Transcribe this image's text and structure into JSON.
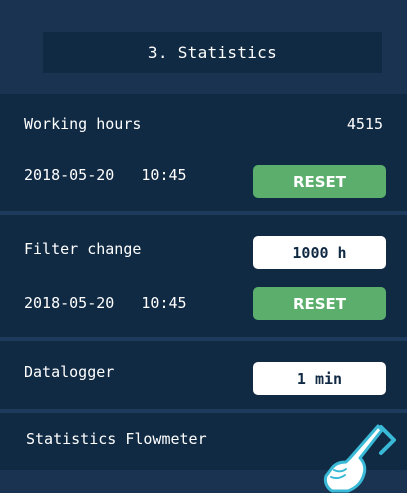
{
  "header": {
    "title": "3. Statistics"
  },
  "working_hours": {
    "label": "Working hours",
    "value": "4515",
    "date": "2018-05-20",
    "time": "10:45",
    "reset_label": "RESET"
  },
  "filter_change": {
    "label": "Filter change",
    "interval": "1000 h",
    "date": "2018-05-20",
    "time": "10:45",
    "reset_label": "RESET"
  },
  "datalogger": {
    "label": "Datalogger",
    "interval": "1 min"
  },
  "flowmeter": {
    "label": "Statistics Flowmeter"
  },
  "icons": {
    "next": "chevron-right-icon",
    "pointer": "hand-pointer-icon"
  },
  "colors": {
    "background": "#1a3350",
    "panel": "#112a44",
    "reset_button": "#5cae6c",
    "accent": "#39b9d6",
    "value_button": "#ffffff"
  }
}
